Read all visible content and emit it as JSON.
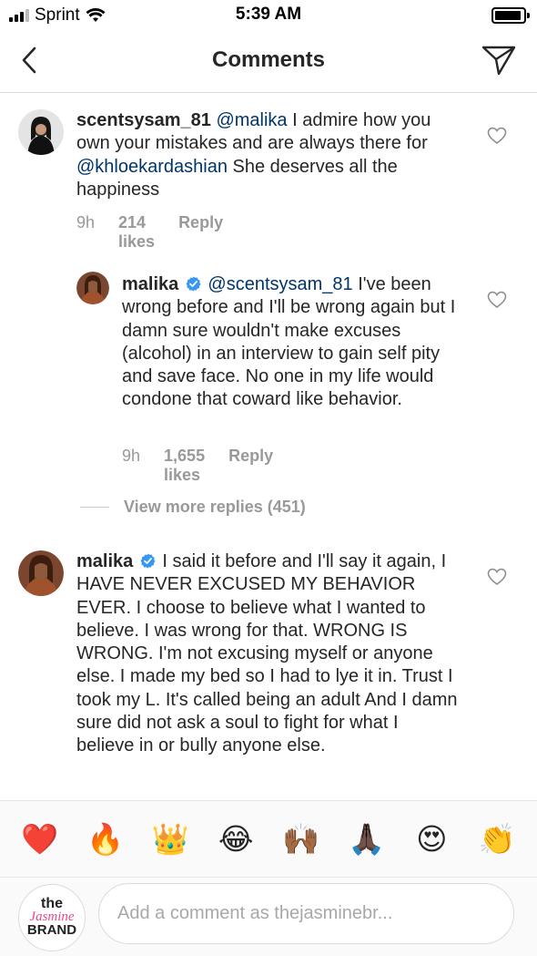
{
  "status_bar": {
    "carrier": "Sprint",
    "time": "5:39 AM"
  },
  "header": {
    "title": "Comments",
    "back_icon": "chevron-left-icon",
    "direct_icon": "paper-plane-icon"
  },
  "comments": [
    {
      "username": "scentsysam_81",
      "mention": "@malika",
      "text_a": " I admire how you own your mistakes and are always there for ",
      "mention2": "@khloekardashian",
      "text_b": " She deserves all the happiness",
      "time": "9h",
      "likes": "214 likes",
      "reply": "Reply"
    },
    {
      "username": "malika",
      "mention": "@scentsysam_81",
      "text": " I've been wrong before and I'll be wrong again but I damn sure wouldn't make excuses (alcohol) in an interview to gain self pity and save face. No one in my life would condone that coward like behavior.",
      "time": "9h",
      "likes": "1,655 likes",
      "reply": "Reply"
    },
    {
      "username": "malika",
      "text": " I said it before and I'll say it again, I HAVE NEVER EXCUSED MY BEHAVIOR EVER. I choose to believe what I wanted to believe. I was wrong for that. WRONG IS WRONG. I'm not excusing myself or anyone else. I made my bed so I had to lye it in. Trust I took my L. It's called being an adult And I damn sure did not ask a soul to fight for what I believe in or bully anyone else."
    }
  ],
  "view_more_replies": "View more replies (451)",
  "emoji_bar": [
    "❤️",
    "🔥",
    "👑",
    "😂",
    "🙌🏾",
    "🙏🏿",
    "😍",
    "👏"
  ],
  "input": {
    "placeholder": "Add a comment as thejasminebr..."
  },
  "logo": {
    "line1": "the",
    "line2": "Jasmine",
    "line3": "BRAND"
  },
  "colors": {
    "mention": "#003569",
    "meta_gray": "#999999",
    "verified_blue": "#3897f0"
  }
}
